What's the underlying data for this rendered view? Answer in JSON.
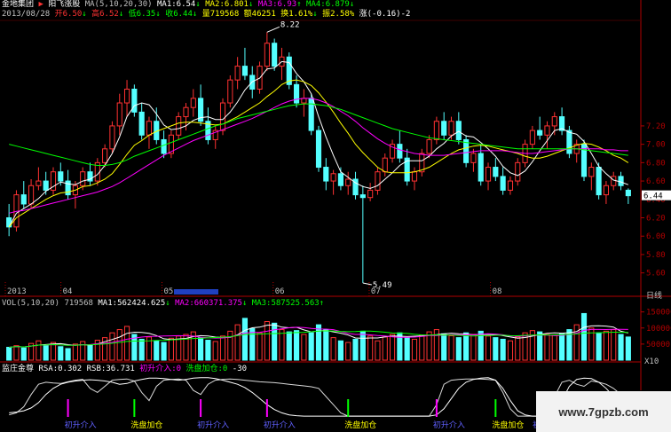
{
  "header": {
    "company": "金地集团",
    "stock": "阳飞涨股",
    "date": "2013/08/28",
    "open": "开6.50",
    "high": "高6.52",
    "low": "低6.35",
    "close": "收6.44",
    "volume": "量719568",
    "amount": "额46251",
    "turnover": "换1.61%",
    "amplitude": "振2.58%",
    "change": "涨(-0.16)-2",
    "ma_label": "MA(5,10,20,30)",
    "ma1": "MA1:6.54",
    "ma2": "MA2:6.801",
    "ma3": "MA3:6.93",
    "ma4": "MA4:6.879"
  },
  "vol_header": {
    "label": "VOL(5,10,20)",
    "value": "719568",
    "ma1": "MA1:562424.625",
    "ma2": "MA2:660371.375",
    "ma3": "MA3:587525.563"
  },
  "ind_header": {
    "name": "监庄金尊",
    "rsa": "RSA:0.302",
    "rsb": "RSB:36.731",
    "s1": "初升介入:0",
    "s2": "洗盘加仓:0",
    "s3": "-30"
  },
  "tabs": [
    "日线"
  ],
  "x_labels": [
    "2013",
    "04",
    "05",
    "06",
    "07",
    "08"
  ],
  "bottom_labels": [
    "初升介入",
    "洗盘加仓",
    "初升介入",
    "初升介入",
    "洗盘加仓",
    "初升介入",
    "洗盘加仓",
    "初升介入"
  ],
  "scale_label": "X10",
  "watermark": "www.7gpzb.com",
  "colors": {
    "up": "#ff3232",
    "down": "#54ffff",
    "ma1": "#ffffff",
    "ma2": "#ffff00",
    "ma3": "#ff00ff",
    "ma4": "#00ff00",
    "axis": "#b00000"
  },
  "chart_data": [
    {
      "type": "candlestick",
      "title": "",
      "y_ticks": [
        5.6,
        5.8,
        6.0,
        6.2,
        6.4,
        6.6,
        6.8,
        7.0,
        7.2
      ],
      "ylim": [
        5.5,
        8.3
      ],
      "current_price": 6.44,
      "annotations": [
        {
          "label": "8.22",
          "value": 8.22
        },
        {
          "label": "5.49",
          "value": 5.49
        }
      ],
      "ohlc": [
        [
          6.2,
          6.35,
          6.0,
          6.1
        ],
        [
          6.1,
          6.5,
          6.05,
          6.45
        ],
        [
          6.45,
          6.6,
          6.3,
          6.35
        ],
        [
          6.35,
          6.62,
          6.3,
          6.55
        ],
        [
          6.55,
          6.75,
          6.5,
          6.6
        ],
        [
          6.6,
          6.7,
          6.45,
          6.5
        ],
        [
          6.5,
          6.75,
          6.45,
          6.7
        ],
        [
          6.7,
          6.8,
          6.55,
          6.6
        ],
        [
          6.6,
          6.72,
          6.4,
          6.45
        ],
        [
          6.45,
          6.6,
          6.3,
          6.55
        ],
        [
          6.55,
          6.75,
          6.5,
          6.7
        ],
        [
          6.7,
          6.8,
          6.55,
          6.6
        ],
        [
          6.6,
          6.85,
          6.55,
          6.8
        ],
        [
          6.8,
          7.0,
          6.75,
          6.95
        ],
        [
          6.95,
          7.25,
          6.9,
          7.2
        ],
        [
          7.2,
          7.55,
          7.1,
          7.45
        ],
        [
          7.45,
          7.7,
          7.3,
          7.6
        ],
        [
          7.6,
          7.65,
          7.3,
          7.35
        ],
        [
          7.35,
          7.45,
          7.05,
          7.1
        ],
        [
          7.1,
          7.3,
          6.95,
          7.25
        ],
        [
          7.25,
          7.4,
          7.0,
          7.05
        ],
        [
          7.05,
          7.15,
          6.85,
          6.9
        ],
        [
          6.9,
          7.15,
          6.85,
          7.1
        ],
        [
          7.1,
          7.35,
          7.05,
          7.3
        ],
        [
          7.3,
          7.45,
          7.15,
          7.4
        ],
        [
          7.4,
          7.6,
          7.3,
          7.5
        ],
        [
          7.5,
          7.65,
          7.2,
          7.25
        ],
        [
          7.25,
          7.4,
          7.0,
          7.05
        ],
        [
          7.05,
          7.2,
          6.95,
          7.15
        ],
        [
          7.15,
          7.5,
          7.1,
          7.45
        ],
        [
          7.45,
          7.75,
          7.4,
          7.7
        ],
        [
          7.7,
          7.95,
          7.6,
          7.85
        ],
        [
          7.85,
          8.05,
          7.7,
          7.75
        ],
        [
          7.75,
          7.85,
          7.5,
          7.6
        ],
        [
          7.6,
          7.9,
          7.55,
          7.85
        ],
        [
          7.85,
          8.22,
          7.8,
          8.1
        ],
        [
          8.1,
          8.15,
          7.8,
          7.85
        ],
        [
          7.85,
          8.05,
          7.7,
          7.95
        ],
        [
          7.95,
          8.0,
          7.6,
          7.65
        ],
        [
          7.65,
          7.75,
          7.4,
          7.45
        ],
        [
          7.45,
          7.6,
          7.3,
          7.5
        ],
        [
          7.5,
          7.55,
          7.1,
          7.15
        ],
        [
          7.15,
          7.2,
          6.7,
          6.75
        ],
        [
          6.75,
          6.85,
          6.5,
          6.6
        ],
        [
          6.6,
          6.72,
          6.45,
          6.68
        ],
        [
          6.68,
          6.75,
          6.5,
          6.55
        ],
        [
          6.55,
          6.7,
          6.45,
          6.62
        ],
        [
          6.62,
          6.7,
          6.4,
          6.45
        ],
        [
          6.45,
          6.55,
          5.49,
          6.42
        ],
        [
          6.42,
          6.58,
          6.38,
          6.5
        ],
        [
          6.5,
          6.75,
          6.45,
          6.7
        ],
        [
          6.7,
          6.9,
          6.65,
          6.85
        ],
        [
          6.85,
          7.05,
          6.8,
          7.0
        ],
        [
          7.0,
          7.15,
          6.8,
          6.85
        ],
        [
          6.85,
          6.95,
          6.55,
          6.6
        ],
        [
          6.6,
          6.75,
          6.5,
          6.7
        ],
        [
          6.7,
          6.95,
          6.65,
          6.9
        ],
        [
          6.9,
          7.1,
          6.85,
          7.05
        ],
        [
          7.05,
          7.3,
          7.0,
          7.25
        ],
        [
          7.25,
          7.35,
          7.05,
          7.1
        ],
        [
          7.1,
          7.3,
          7.05,
          7.25
        ],
        [
          7.25,
          7.35,
          7.0,
          7.05
        ],
        [
          7.05,
          7.1,
          6.75,
          6.8
        ],
        [
          6.8,
          6.95,
          6.7,
          6.9
        ],
        [
          6.9,
          7.0,
          6.55,
          6.6
        ],
        [
          6.6,
          6.8,
          6.5,
          6.75
        ],
        [
          6.75,
          6.85,
          6.6,
          6.65
        ],
        [
          6.65,
          6.75,
          6.45,
          6.5
        ],
        [
          6.5,
          6.65,
          6.45,
          6.6
        ],
        [
          6.6,
          6.85,
          6.55,
          6.8
        ],
        [
          6.8,
          7.05,
          6.75,
          7.0
        ],
        [
          7.0,
          7.2,
          6.95,
          7.15
        ],
        [
          7.15,
          7.3,
          7.05,
          7.1
        ],
        [
          7.1,
          7.25,
          6.95,
          7.2
        ],
        [
          7.2,
          7.35,
          7.1,
          7.3
        ],
        [
          7.3,
          7.4,
          7.1,
          7.15
        ],
        [
          7.15,
          7.2,
          6.85,
          6.9
        ],
        [
          6.9,
          7.05,
          6.8,
          7.0
        ],
        [
          7.0,
          7.05,
          6.6,
          6.65
        ],
        [
          6.65,
          6.8,
          6.5,
          6.75
        ],
        [
          6.75,
          6.8,
          6.4,
          6.45
        ],
        [
          6.45,
          6.6,
          6.35,
          6.55
        ],
        [
          6.55,
          6.7,
          6.5,
          6.65
        ],
        [
          6.65,
          6.7,
          6.5,
          6.55
        ],
        [
          6.5,
          6.52,
          6.35,
          6.44
        ]
      ],
      "series": [
        {
          "name": "MA1",
          "values": [
            6.1,
            6.25,
            6.3,
            6.35,
            6.41,
            6.49,
            6.54,
            6.59,
            6.57,
            6.56,
            6.6,
            6.62,
            6.67,
            6.77,
            6.9,
            7.08,
            7.3,
            7.42,
            7.45,
            7.43,
            7.33,
            7.21,
            7.16,
            7.17,
            7.2,
            7.26,
            7.29,
            7.3,
            7.27,
            7.27,
            7.35,
            7.46,
            7.59,
            7.68,
            7.72,
            7.82,
            7.83,
            7.9,
            7.89,
            7.77,
            7.68,
            7.55,
            7.3,
            7.08,
            6.88,
            6.7,
            6.64,
            6.58,
            6.54,
            6.52,
            6.55,
            6.62,
            6.69,
            6.77,
            6.82,
            6.82,
            6.82,
            6.87,
            6.95,
            7.01,
            7.09,
            7.14,
            7.09,
            7.08,
            7.02,
            6.95,
            6.87,
            6.76,
            6.69,
            6.66,
            6.71,
            6.81,
            6.93,
            7.04,
            7.15,
            7.17,
            7.13,
            7.11,
            7.03,
            6.9,
            6.76,
            6.68,
            6.61,
            6.59,
            6.56
          ]
        },
        {
          "name": "MA2",
          "values": [
            6.1,
            6.2,
            6.25,
            6.3,
            6.35,
            6.4,
            6.44,
            6.47,
            6.48,
            6.5,
            6.54,
            6.55,
            6.58,
            6.62,
            6.68,
            6.78,
            6.89,
            6.99,
            7.04,
            7.1,
            7.14,
            7.17,
            7.2,
            7.23,
            7.24,
            7.24,
            7.23,
            7.22,
            7.21,
            7.22,
            7.26,
            7.3,
            7.35,
            7.4,
            7.45,
            7.52,
            7.58,
            7.65,
            7.69,
            7.7,
            7.68,
            7.64,
            7.56,
            7.46,
            7.35,
            7.23,
            7.12,
            7.0,
            6.91,
            6.83,
            6.75,
            6.7,
            6.69,
            6.69,
            6.69,
            6.7,
            6.72,
            6.75,
            6.8,
            6.85,
            6.9,
            6.94,
            6.96,
            6.98,
            6.99,
            6.98,
            6.96,
            6.94,
            6.92,
            6.9,
            6.87,
            6.85,
            6.85,
            6.87,
            6.9,
            6.93,
            6.96,
            6.99,
            7.01,
            7.0,
            6.97,
            6.93,
            6.88,
            6.85,
            6.8
          ]
        },
        {
          "name": "MA3",
          "values": [
            6.25,
            6.27,
            6.28,
            6.3,
            6.32,
            6.34,
            6.36,
            6.38,
            6.4,
            6.42,
            6.44,
            6.46,
            6.48,
            6.51,
            6.54,
            6.58,
            6.63,
            6.68,
            6.73,
            6.78,
            6.83,
            6.88,
            6.92,
            6.96,
            7.0,
            7.04,
            7.07,
            7.1,
            7.13,
            7.16,
            7.19,
            7.22,
            7.25,
            7.28,
            7.32,
            7.36,
            7.4,
            7.44,
            7.47,
            7.49,
            7.5,
            7.5,
            7.48,
            7.45,
            7.41,
            7.36,
            7.31,
            7.25,
            7.18,
            7.12,
            7.06,
            7.01,
            6.97,
            6.94,
            6.92,
            6.9,
            6.89,
            6.88,
            6.88,
            6.88,
            6.89,
            6.9,
            6.91,
            6.92,
            6.93,
            6.93,
            6.93,
            6.93,
            6.92,
            6.91,
            6.9,
            6.9,
            6.91,
            6.92,
            6.93,
            6.94,
            6.95,
            6.95,
            6.95,
            6.95,
            6.95,
            6.94,
            6.94,
            6.93,
            6.93
          ]
        },
        {
          "name": "MA4",
          "values": [
            7.0,
            6.98,
            6.96,
            6.94,
            6.92,
            6.9,
            6.88,
            6.86,
            6.84,
            6.82,
            6.8,
            6.78,
            6.77,
            6.77,
            6.78,
            6.8,
            6.83,
            6.87,
            6.9,
            6.93,
            6.96,
            6.99,
            7.02,
            7.05,
            7.08,
            7.11,
            7.14,
            7.17,
            7.2,
            7.22,
            7.25,
            7.28,
            7.3,
            7.32,
            7.34,
            7.36,
            7.38,
            7.4,
            7.42,
            7.43,
            7.44,
            7.44,
            7.43,
            7.42,
            7.4,
            7.38,
            7.35,
            7.32,
            7.29,
            7.26,
            7.23,
            7.2,
            7.17,
            7.15,
            7.13,
            7.11,
            7.09,
            7.07,
            7.06,
            7.05,
            7.04,
            7.03,
            7.02,
            7.01,
            7.0,
            6.99,
            6.98,
            6.97,
            6.96,
            6.95,
            6.95,
            6.95,
            6.95,
            6.95,
            6.95,
            6.95,
            6.95,
            6.95,
            6.94,
            6.93,
            6.92,
            6.91,
            6.9,
            6.89,
            6.88
          ]
        }
      ]
    },
    {
      "type": "bar",
      "title": "VOL(5,10,20)",
      "y_ticks": [
        50000,
        100000,
        150000
      ],
      "scale": "X10",
      "values": [
        40,
        45,
        38,
        52,
        60,
        48,
        55,
        42,
        36,
        50,
        58,
        47,
        62,
        70,
        85,
        95,
        105,
        80,
        65,
        72,
        60,
        55,
        68,
        75,
        80,
        88,
        70,
        62,
        58,
        75,
        90,
        110,
        130,
        98,
        85,
        120,
        115,
        95,
        88,
        92,
        80,
        85,
        110,
        95,
        70,
        60,
        55,
        65,
        90,
        75,
        60,
        72,
        80,
        85,
        70,
        65,
        78,
        88,
        95,
        82,
        76,
        70,
        85,
        80,
        90,
        75,
        70,
        65,
        60,
        72,
        85,
        92,
        88,
        80,
        78,
        82,
        95,
        110,
        145,
        100,
        85,
        90,
        95,
        80,
        72
      ]
    },
    {
      "type": "line",
      "title": "监庄金尊",
      "series": [
        {
          "name": "RSA",
          "values": [
            0.1,
            0.12,
            0.15,
            0.22,
            0.35,
            0.55,
            0.7,
            0.8,
            0.85,
            0.88,
            0.9,
            0.91,
            0.9,
            0.88,
            0.85,
            0.8,
            0.82,
            0.88,
            0.92,
            0.95,
            0.95,
            0.94,
            0.92,
            0.9,
            0.92,
            0.95,
            0.96,
            0.96,
            0.94,
            0.9,
            0.85,
            0.8,
            0.72,
            0.6,
            0.45,
            0.3,
            0.18,
            0.1,
            0.05,
            0.03,
            0.02,
            0.02,
            0.02,
            0.02,
            0.02,
            0.02,
            0.02,
            0.02,
            0.02,
            0.02,
            0.02,
            0.02,
            0.02,
            0.02,
            0.02,
            0.02,
            0.02,
            0.02,
            0.05,
            0.2,
            0.45,
            0.7,
            0.85,
            0.92,
            0.95,
            0.96,
            0.9,
            0.7,
            0.4,
            0.15,
            0.05,
            0.02,
            0.02,
            0.02,
            0.1,
            0.4,
            0.75,
            0.92,
            0.95,
            0.94,
            0.85,
            0.7,
            0.5,
            0.35,
            0.3
          ]
        },
        {
          "name": "RSB",
          "values": [
            0.05,
            0.1,
            0.25,
            0.55,
            0.8,
            0.85,
            0.83,
            0.82,
            0.86,
            0.9,
            0.92,
            0.7,
            0.6,
            0.75,
            0.9,
            0.92,
            0.93,
            0.88,
            0.6,
            0.4,
            0.75,
            0.9,
            0.92,
            0.93,
            0.9,
            0.65,
            0.55,
            0.8,
            0.9,
            0.92,
            0.93,
            0.92,
            0.9,
            0.88,
            0.86,
            0.85,
            0.84,
            0.82,
            0.8,
            0.78,
            0.76,
            0.74,
            0.7,
            0.5,
            0.3,
            0.1,
            0.02,
            0.02,
            0.02,
            0.02,
            0.02,
            0.02,
            0.02,
            0.02,
            0.02,
            0.02,
            0.02,
            0.02,
            0.3,
            0.8,
            0.9,
            0.92,
            0.93,
            0.93,
            0.93,
            0.92,
            0.9,
            0.6,
            0.2,
            0.02,
            0.02,
            0.02,
            0.02,
            0.02,
            0.5,
            0.85,
            0.9,
            0.8,
            0.75,
            0.88,
            0.85,
            0.8,
            0.7,
            0.55,
            0.4
          ]
        }
      ],
      "signals": {
        "初升介入": [
          8,
          26,
          35,
          58,
          80
        ],
        "洗盘加仓": [
          17,
          46,
          66
        ]
      }
    }
  ]
}
